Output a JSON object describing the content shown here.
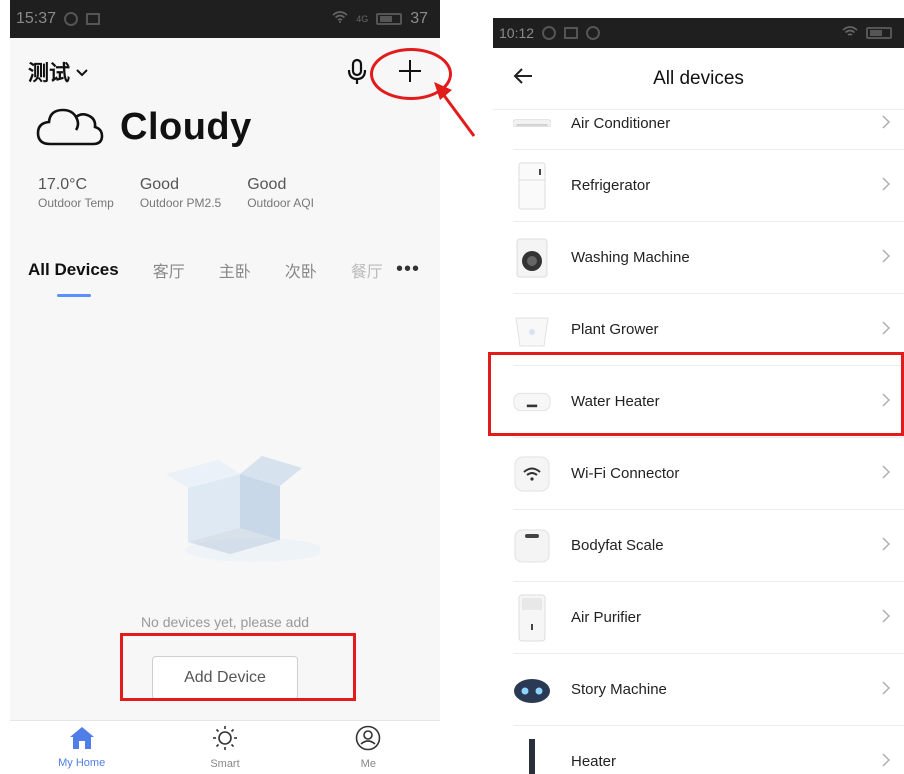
{
  "left": {
    "status_time": "15:37",
    "status_battery": "37",
    "home_name": "测试",
    "weather": {
      "condition": "Cloudy"
    },
    "metrics": [
      {
        "value": "17.0°C",
        "label": "Outdoor Temp"
      },
      {
        "value": "Good",
        "label": "Outdoor PM2.5"
      },
      {
        "value": "Good",
        "label": "Outdoor AQI"
      }
    ],
    "tabs": [
      "All Devices",
      "客厅",
      "主卧",
      "次卧",
      "餐厅"
    ],
    "more": "•••",
    "empty_text": "No devices yet, please add",
    "add_button": "Add Device",
    "nav": [
      {
        "label": "My Home"
      },
      {
        "label": "Smart"
      },
      {
        "label": "Me"
      }
    ],
    "colors": {
      "accent": "#4f7ee8",
      "highlight": "#e21b1b"
    }
  },
  "right": {
    "status_time": "10:12",
    "title": "All devices",
    "devices": [
      {
        "name": "Air Conditioner",
        "icon": "air-conditioner-icon"
      },
      {
        "name": "Refrigerator",
        "icon": "refrigerator-icon"
      },
      {
        "name": "Washing Machine",
        "icon": "washing-machine-icon"
      },
      {
        "name": "Plant Grower",
        "icon": "plant-grower-icon"
      },
      {
        "name": "Water Heater",
        "icon": "water-heater-icon"
      },
      {
        "name": "Wi-Fi Connector",
        "icon": "wifi-connector-icon"
      },
      {
        "name": "Bodyfat Scale",
        "icon": "bodyfat-scale-icon"
      },
      {
        "name": "Air Purifier",
        "icon": "air-purifier-icon"
      },
      {
        "name": "Story Machine",
        "icon": "story-machine-icon"
      },
      {
        "name": "Heater",
        "icon": "heater-icon"
      }
    ]
  }
}
